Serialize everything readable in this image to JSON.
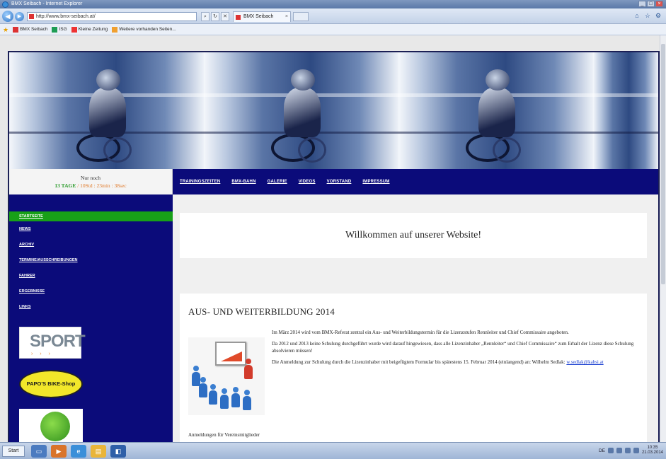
{
  "browser": {
    "window_title": "BMX Seibach - Internet Explorer",
    "address": "http://www.bmx-seibach.at/",
    "tab_title": "BMX Seibach",
    "favorites": [
      {
        "label": "BMX Seibach",
        "color": "#d33"
      },
      {
        "label": "ISG",
        "color": "#1f9d55"
      },
      {
        "label": "Kleine Zeitung",
        "color": "#e33"
      },
      {
        "label": "Weitere vorhanden Seiten...",
        "color": "#f0a030"
      }
    ]
  },
  "countdown": {
    "line1": "Nur noch",
    "days": "13 TAGE",
    "time": "/ 10Std : 23min : 38sec"
  },
  "top_nav": [
    "TRAININGSZEITEN",
    "BMX-BAHN",
    "GALERIE",
    "VIDEOS",
    "VORSTAND",
    "IMPRESSUM"
  ],
  "sidebar": {
    "items": [
      "STARTSEITE",
      "NEWS",
      "ARCHIV",
      "TERMINE/AUSSCHREIBUNGEN",
      "FAHRER",
      "ERGEBNISSE",
      "LINKS"
    ],
    "active_index": 0,
    "sponsors": {
      "sport": "SPORT",
      "papo": "PAPO'S BIKE-Shop"
    }
  },
  "main": {
    "welcome": "Willkommen auf unserer Website!",
    "article": {
      "title": "AUS- UND WEITERBILDUNG 2014",
      "p1": "Im März 2014 wird vom BMX-Referat zentral ein Aus- und Weiterbildungstermin für die Lizenzstufen Renn­leiter und Chief Commissaire angeboten.",
      "p2": "Da 2012 und 2013 keine Schulung durchgeführt wurde wird darauf hingewiesen, dass alle Lizenzinhaber „Rennleiter“ und Chief Commissaire“ zum Erhalt der Lizenz diese Schulung absolvieren müssen!",
      "p3_text": "Die Anmeldung zur Schulung durch die Lizenzinhaber mit beigefügtem Formular bis spätestens 15. Februar 2014 (einlangend) an: Wilhelm Sedlak:",
      "p3_email": "w.sedlak@kabsi.at",
      "footer": "Anmeldungen für Vereinsmitglieder"
    }
  },
  "taskbar": {
    "start": "Start",
    "clock_time": "10:35",
    "clock_date": "21.03.2014",
    "lang": "DE"
  }
}
